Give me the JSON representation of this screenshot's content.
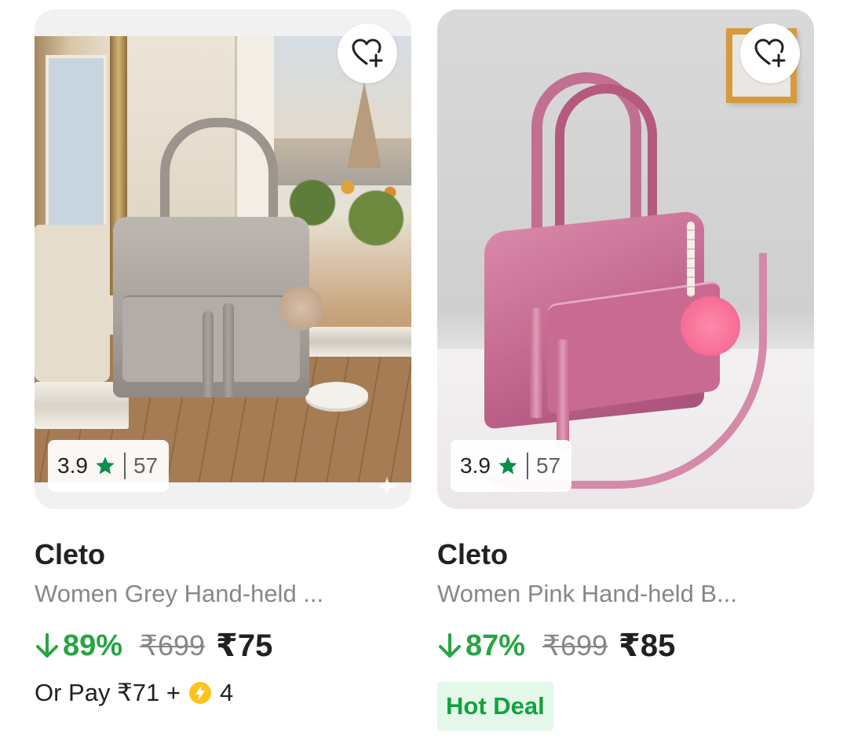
{
  "colors": {
    "discount_green": "#26a541",
    "hot_deal_bg": "#e4f8e9",
    "hot_deal_text": "#10a33d",
    "star_green": "#0c8f4b",
    "muted_text": "#878787",
    "coin_yellow": "#ffc21f"
  },
  "icons": {
    "wishlist": "heart-plus-icon",
    "rating": "star-icon",
    "discount": "arrow-down-icon",
    "coin": "supercoin-lightning-icon",
    "ad_marker": "sparkle-icon"
  },
  "products": [
    {
      "rating": "3.9",
      "rating_count": "57",
      "brand": "Cleto",
      "title": "Women Grey Hand-held ...",
      "discount": "89%",
      "mrp": "₹699",
      "price": "₹75",
      "pay_prefix": "Or Pay ₹71 +",
      "coins": "4"
    },
    {
      "rating": "3.9",
      "rating_count": "57",
      "brand": "Cleto",
      "title": "Women Pink Hand-held B...",
      "discount": "87%",
      "mrp": "₹699",
      "price": "₹85",
      "badge": "Hot Deal"
    }
  ]
}
